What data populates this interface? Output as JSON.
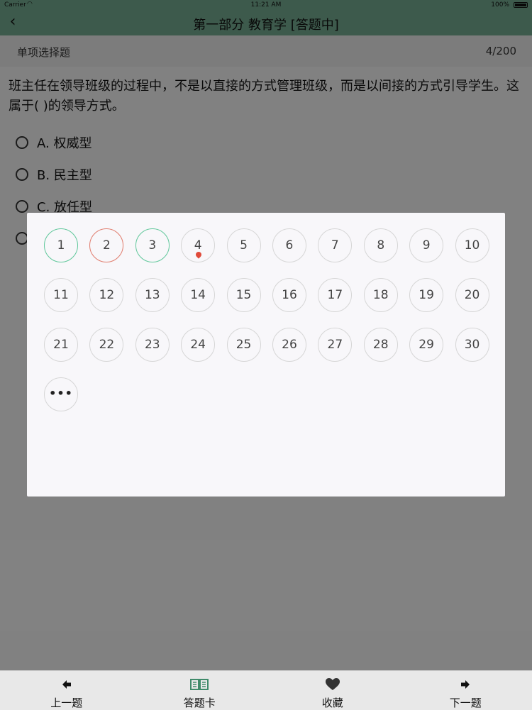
{
  "status_bar": {
    "carrier": "Carrier",
    "time": "11:21 AM",
    "battery": "100%"
  },
  "nav": {
    "title": "第一部分 教育学 [答题中]",
    "back_icon": "chevron-left-icon"
  },
  "subheader": {
    "question_type": "单项选择题",
    "progress": "4/200"
  },
  "question": {
    "text": "班主任在领导班级的过程中，不是以直接的方式管理班级，而是以间接的方式引导学生。这属于(   )的领导方式。",
    "options": [
      {
        "label": "A. 权威型"
      },
      {
        "label": "B. 民主型"
      },
      {
        "label": "C. 放任型"
      },
      {
        "label": ""
      }
    ]
  },
  "answer_card": {
    "more_label": "•••",
    "items": [
      {
        "n": "1",
        "state": "correct"
      },
      {
        "n": "2",
        "state": "wrong"
      },
      {
        "n": "3",
        "state": "correct"
      },
      {
        "n": "4",
        "state": "current"
      },
      {
        "n": "5",
        "state": "unanswered"
      },
      {
        "n": "6",
        "state": "unanswered"
      },
      {
        "n": "7",
        "state": "unanswered"
      },
      {
        "n": "8",
        "state": "unanswered"
      },
      {
        "n": "9",
        "state": "unanswered"
      },
      {
        "n": "10",
        "state": "unanswered"
      },
      {
        "n": "11",
        "state": "unanswered"
      },
      {
        "n": "12",
        "state": "unanswered"
      },
      {
        "n": "13",
        "state": "unanswered"
      },
      {
        "n": "14",
        "state": "unanswered"
      },
      {
        "n": "15",
        "state": "unanswered"
      },
      {
        "n": "16",
        "state": "unanswered"
      },
      {
        "n": "17",
        "state": "unanswered"
      },
      {
        "n": "18",
        "state": "unanswered"
      },
      {
        "n": "19",
        "state": "unanswered"
      },
      {
        "n": "20",
        "state": "unanswered"
      },
      {
        "n": "21",
        "state": "unanswered"
      },
      {
        "n": "22",
        "state": "unanswered"
      },
      {
        "n": "23",
        "state": "unanswered"
      },
      {
        "n": "24",
        "state": "unanswered"
      },
      {
        "n": "25",
        "state": "unanswered"
      },
      {
        "n": "26",
        "state": "unanswered"
      },
      {
        "n": "27",
        "state": "unanswered"
      },
      {
        "n": "28",
        "state": "unanswered"
      },
      {
        "n": "29",
        "state": "unanswered"
      },
      {
        "n": "30",
        "state": "unanswered"
      }
    ]
  },
  "tabbar": {
    "prev": {
      "label": "上一题",
      "icon": "arrow-left-icon"
    },
    "card": {
      "label": "答题卡",
      "icon": "open-book-icon"
    },
    "favorite": {
      "label": "收藏",
      "icon": "heart-icon"
    },
    "next": {
      "label": "下一题",
      "icon": "arrow-right-icon"
    }
  },
  "colors": {
    "header": "#6fa48a",
    "correct": "#5fc79a",
    "wrong": "#e07b6c",
    "accent_icon": "#3f8a6a"
  }
}
